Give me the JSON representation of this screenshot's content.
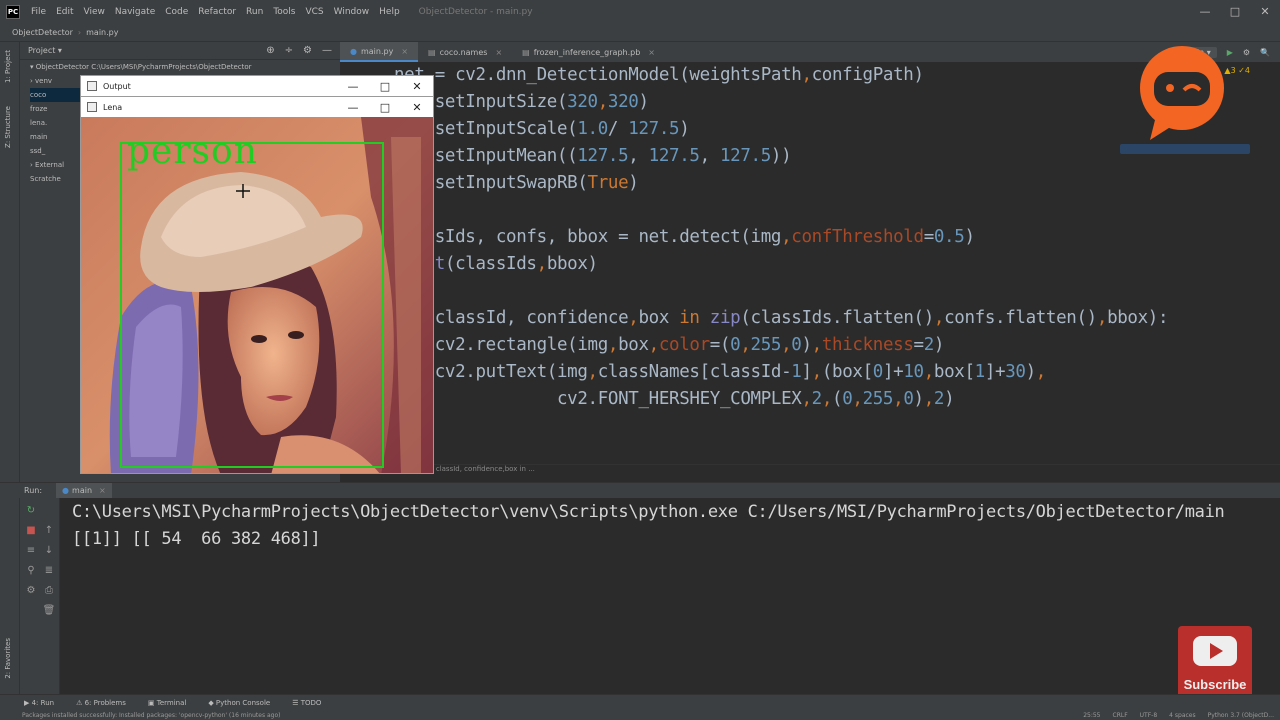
{
  "menu": {
    "items": [
      "File",
      "Edit",
      "View",
      "Navigate",
      "Code",
      "Refactor",
      "Run",
      "Tools",
      "VCS",
      "Window",
      "Help"
    ],
    "window_title": "ObjectDetector - main.py",
    "min": "—",
    "max": "□",
    "close": "✕"
  },
  "nav": {
    "project": "ObjectDetector",
    "file": "main.py"
  },
  "stripe": {
    "project": "1: Project",
    "structure": "Z: Structure",
    "favorites": "2: Favorites"
  },
  "project_panel": {
    "title": "Project ▾",
    "tools": [
      "⊕",
      "÷",
      "⚙",
      "—"
    ],
    "tree": [
      {
        "label": "▾ ObjectDetector  C:\\Users\\MSI\\PycharmProjects\\ObjectDetector",
        "selected": false
      },
      {
        "label": "  › venv",
        "selected": false
      },
      {
        "label": "    coco",
        "selected": true
      },
      {
        "label": "    froze",
        "selected": false
      },
      {
        "label": "    lena.",
        "selected": false
      },
      {
        "label": "    main",
        "selected": false
      },
      {
        "label": "    ssd_",
        "selected": false
      },
      {
        "label": "› External",
        "selected": false
      },
      {
        "label": "  Scratche",
        "selected": false
      }
    ]
  },
  "tabs": [
    {
      "label": "main.py",
      "active": true
    },
    {
      "label": "coco.names",
      "active": false
    },
    {
      "label": "frozen_inference_graph.pb",
      "active": false
    }
  ],
  "run_config": {
    "name": "main ▾",
    "run": "▶",
    "debug": "⚙",
    "search": "🔍"
  },
  "editor": {
    "warnings": "▲3 ✓4",
    "breadcrumb": "for classId, confidence,box in ..."
  },
  "code": [
    {
      "segments": [
        {
          "t": "net = cv2.dnn_DetectionModel(weightsPath",
          "c": ""
        },
        {
          "t": ",",
          "c": "kw"
        },
        {
          "t": "configPath)",
          "c": ""
        }
      ]
    },
    {
      "segments": [
        {
          "t": "net.setInputSize(",
          "c": ""
        },
        {
          "t": "320",
          "c": "num"
        },
        {
          "t": ",",
          "c": "kw"
        },
        {
          "t": "320",
          "c": "num"
        },
        {
          "t": ")",
          "c": ""
        }
      ]
    },
    {
      "segments": [
        {
          "t": "net.setInputScale(",
          "c": ""
        },
        {
          "t": "1.0",
          "c": "num"
        },
        {
          "t": "/ ",
          "c": ""
        },
        {
          "t": "127.5",
          "c": "num"
        },
        {
          "t": ")",
          "c": ""
        }
      ]
    },
    {
      "segments": [
        {
          "t": "net.setInputMean((",
          "c": ""
        },
        {
          "t": "127.5",
          "c": "num"
        },
        {
          "t": ", ",
          "c": ""
        },
        {
          "t": "127.5",
          "c": "num"
        },
        {
          "t": ", ",
          "c": ""
        },
        {
          "t": "127.5",
          "c": "num"
        },
        {
          "t": "))",
          "c": ""
        }
      ]
    },
    {
      "segments": [
        {
          "t": "net.setInputSwapRB(",
          "c": ""
        },
        {
          "t": "True",
          "c": "kw"
        },
        {
          "t": ")",
          "c": ""
        }
      ]
    },
    {
      "segments": []
    },
    {
      "segments": [
        {
          "t": "classIds, confs, bbox = net.detect(img",
          "c": ""
        },
        {
          "t": ",",
          "c": "kw"
        },
        {
          "t": "confThreshold",
          "c": "param"
        },
        {
          "t": "=",
          "c": ""
        },
        {
          "t": "0.5",
          "c": "num"
        },
        {
          "t": ")",
          "c": ""
        }
      ]
    },
    {
      "segments": [
        {
          "t": "print",
          "c": "builtin"
        },
        {
          "t": "(classIds",
          "c": ""
        },
        {
          "t": ",",
          "c": "kw"
        },
        {
          "t": "bbox)",
          "c": ""
        }
      ]
    },
    {
      "segments": []
    },
    {
      "segments": [
        {
          "t": "for",
          "c": "kw"
        },
        {
          "t": " classId, confidence",
          "c": ""
        },
        {
          "t": ",",
          "c": "kw"
        },
        {
          "t": "box ",
          "c": ""
        },
        {
          "t": "in",
          "c": "kw"
        },
        {
          "t": " ",
          "c": ""
        },
        {
          "t": "zip",
          "c": "builtin"
        },
        {
          "t": "(classIds.flatten()",
          "c": ""
        },
        {
          "t": ",",
          "c": "kw"
        },
        {
          "t": "confs.flatten()",
          "c": ""
        },
        {
          "t": ",",
          "c": "kw"
        },
        {
          "t": "bbox):",
          "c": ""
        }
      ]
    },
    {
      "segments": [
        {
          "t": "    cv2.rectangle(img",
          "c": ""
        },
        {
          "t": ",",
          "c": "kw"
        },
        {
          "t": "box",
          "c": ""
        },
        {
          "t": ",",
          "c": "kw"
        },
        {
          "t": "color",
          "c": "param"
        },
        {
          "t": "=(",
          "c": ""
        },
        {
          "t": "0",
          "c": "num"
        },
        {
          "t": ",",
          "c": "kw"
        },
        {
          "t": "255",
          "c": "num"
        },
        {
          "t": ",",
          "c": "kw"
        },
        {
          "t": "0",
          "c": "num"
        },
        {
          "t": ")",
          "c": ""
        },
        {
          "t": ",",
          "c": "kw"
        },
        {
          "t": "thickness",
          "c": "param"
        },
        {
          "t": "=",
          "c": ""
        },
        {
          "t": "2",
          "c": "num"
        },
        {
          "t": ")",
          "c": ""
        }
      ]
    },
    {
      "segments": [
        {
          "t": "    cv2.putText(img",
          "c": ""
        },
        {
          "t": ",",
          "c": "kw"
        },
        {
          "t": "classNames[classId-",
          "c": ""
        },
        {
          "t": "1",
          "c": "num"
        },
        {
          "t": "]",
          "c": ""
        },
        {
          "t": ",",
          "c": "kw"
        },
        {
          "t": "(box[",
          "c": ""
        },
        {
          "t": "0",
          "c": "num"
        },
        {
          "t": "]+",
          "c": ""
        },
        {
          "t": "10",
          "c": "num"
        },
        {
          "t": ",",
          "c": "kw"
        },
        {
          "t": "box[",
          "c": ""
        },
        {
          "t": "1",
          "c": "num"
        },
        {
          "t": "]+",
          "c": ""
        },
        {
          "t": "30",
          "c": "num"
        },
        {
          "t": ")",
          "c": ""
        },
        {
          "t": ",",
          "c": "kw"
        }
      ]
    },
    {
      "segments": [
        {
          "t": "                cv2.FONT_HERSHEY_COMPLEX",
          "c": ""
        },
        {
          "t": ",",
          "c": "kw"
        },
        {
          "t": "2",
          "c": "num"
        },
        {
          "t": ",",
          "c": "kw"
        },
        {
          "t": "(",
          "c": ""
        },
        {
          "t": "0",
          "c": "num"
        },
        {
          "t": ",",
          "c": "kw"
        },
        {
          "t": "255",
          "c": "num"
        },
        {
          "t": ",",
          "c": "kw"
        },
        {
          "t": "0",
          "c": "num"
        },
        {
          "t": ")",
          "c": ""
        },
        {
          "t": ",",
          "c": "kw"
        },
        {
          "t": "2",
          "c": "num"
        },
        {
          "t": ")",
          "c": ""
        }
      ]
    }
  ],
  "run_panel": {
    "label": "Run:",
    "tab": "main",
    "output": [
      "C:\\Users\\MSI\\PycharmProjects\\ObjectDetector\\venv\\Scripts\\python.exe C:/Users/MSI/PycharmProjects/ObjectDetector/main",
      "[[1]] [[ 54  66 382 468]]"
    ]
  },
  "bottom_tools": [
    "▶ 4: Run",
    "⚠ 6: Problems",
    "▣ Terminal",
    "◆ Python Console",
    "☰ TODO"
  ],
  "status": {
    "message": "Packages installed successfully: Installed packages: 'opencv-python' (16 minutes ago)",
    "position": "25:55",
    "line_sep": "CRLF",
    "encoding": "UTF-8",
    "indent": "4 spaces",
    "interpreter": "Python 3.7 (ObjectD..."
  },
  "output_window": {
    "title": "Output"
  },
  "lena_window": {
    "title": "Lena",
    "detection_label": "person"
  },
  "youtube": {
    "label": "Subscribe"
  },
  "colors": {
    "accent": "#4a88c7",
    "detection_green": "#00ff00",
    "youtube_red": "#c4302b",
    "logo_orange": "#f26522"
  }
}
